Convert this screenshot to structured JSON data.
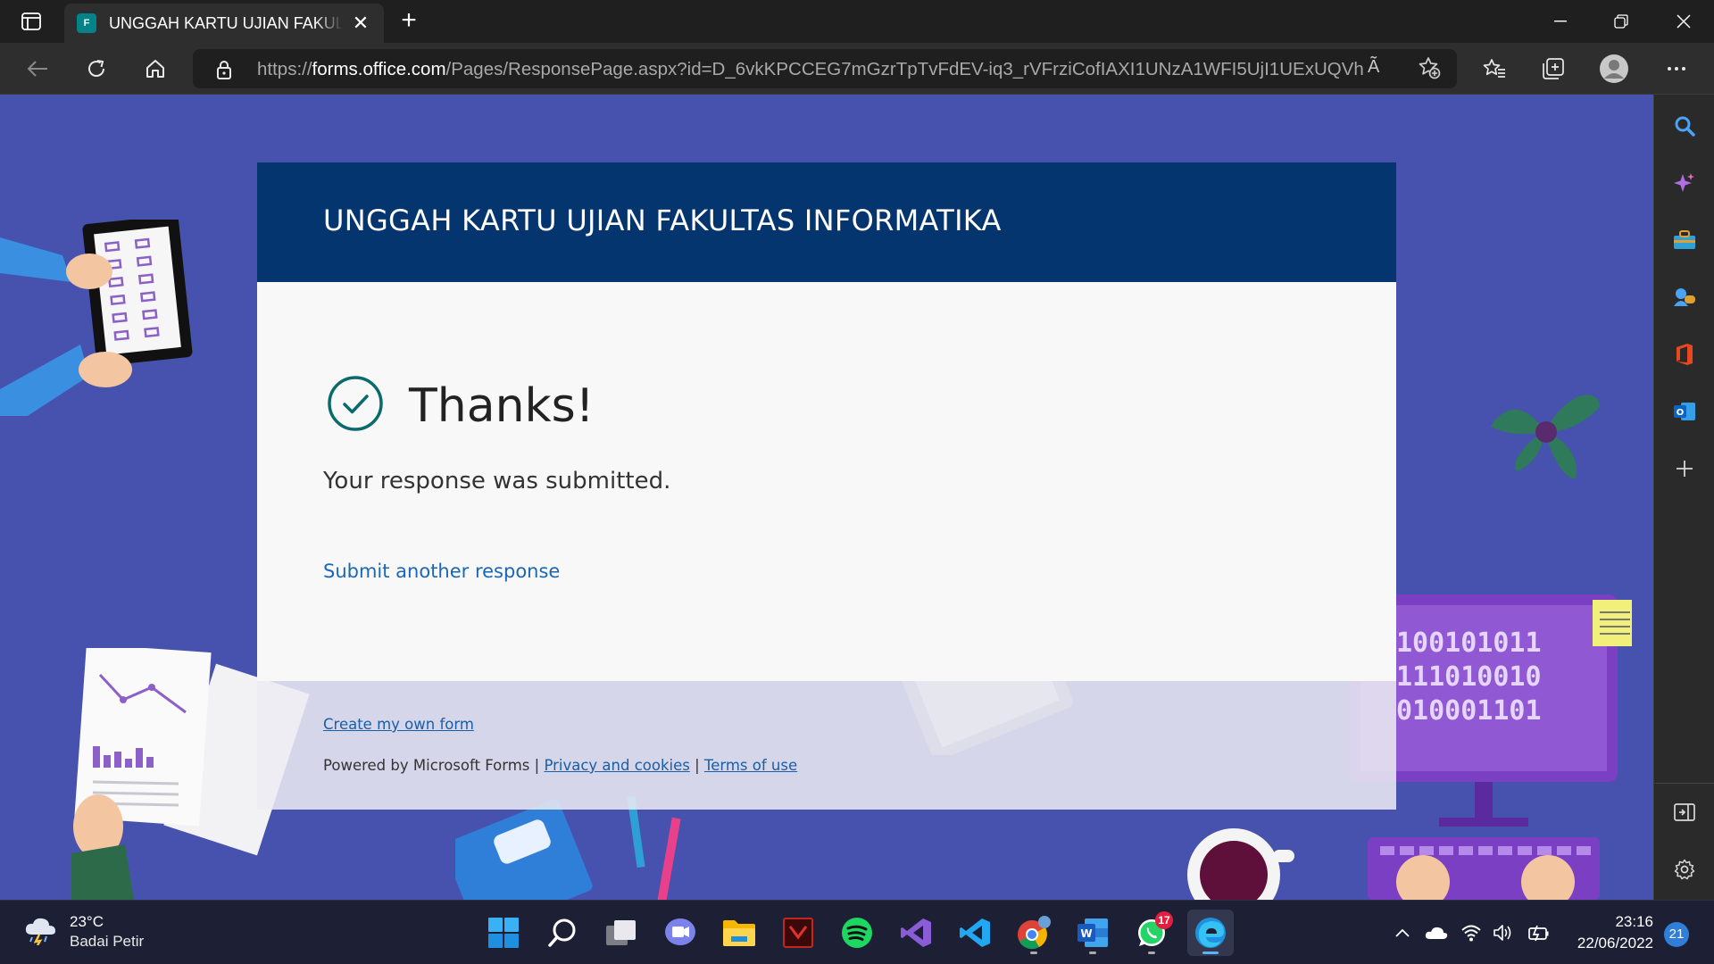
{
  "browser": {
    "tab_title": "UNGGAH KARTU UJIAN FAKULTAS INFORMATIKA",
    "tab_favicon": "F",
    "url_prefix": "https://",
    "url_domain": "forms.office.com",
    "url_path": "/Pages/ResponsePage.aspx?id=D_6vkKPCCEG7mGzrTpTvFdEV-iq3_rVFrziCofIAXI1UNzA1WFI5UjI1UExUQVh...",
    "read_aloud_label": "Ã",
    "new_tab_label": "+"
  },
  "form": {
    "title": "UNGGAH KARTU UJIAN FAKULTAS INFORMATIKA",
    "thanks_title": "Thanks!",
    "submitted_message": "Your response was submitted.",
    "submit_another": "Submit another response",
    "create_own_form": "Create my own form",
    "powered_by": "Powered by Microsoft Forms |",
    "separator": "|",
    "privacy": "Privacy and cookies",
    "terms": "Terms of use",
    "accent_color": "#04356f",
    "check_color": "#0b6a6b",
    "binary_lines": [
      "100101011",
      "111010010",
      "010001101"
    ]
  },
  "taskbar": {
    "weather_temp": "23°C",
    "weather_condition": "Badai Petir",
    "whatsapp_badge": "17",
    "time": "23:16",
    "date": "22/06/2022",
    "notification_count": "21",
    "apps": [
      "start-icon",
      "search-icon",
      "task-view-icon",
      "teams-chat-icon",
      "file-explorer-icon",
      "app-icon",
      "spotify-icon",
      "visual-studio-icon",
      "vscode-icon",
      "chrome-icon",
      "word-icon",
      "whatsapp-icon",
      "edge-icon"
    ]
  }
}
